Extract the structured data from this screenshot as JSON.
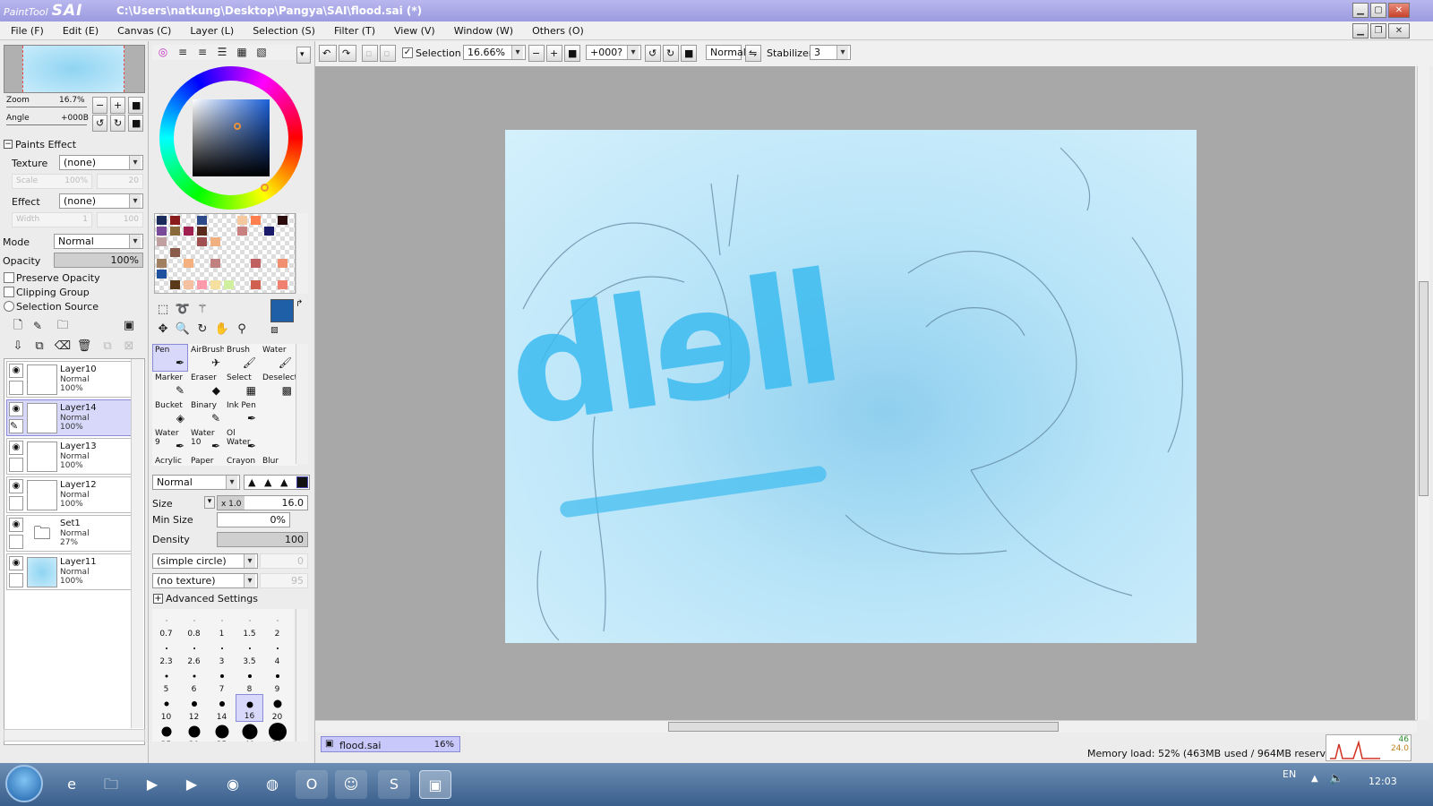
{
  "window": {
    "app_logo_small": "PaintTool",
    "app_logo_big": "SAI",
    "path": "C:\\Users\\natkung\\Desktop\\Pangya\\SAI\\flood.sai (*)"
  },
  "menu": [
    "File (F)",
    "Edit (E)",
    "Canvas (C)",
    "Layer (L)",
    "Selection (S)",
    "Filter (T)",
    "View (V)",
    "Window (W)",
    "Others (O)"
  ],
  "toolbar": {
    "selection_label": "Selection",
    "zoom_value": "16.66%",
    "angle_value": "+000?",
    "blend_mode": "Normal",
    "stabilizer_label": "Stabilizer",
    "stabilizer_value": "3"
  },
  "navigator": {
    "zoom_label": "Zoom",
    "zoom_value": "16.7%",
    "angle_label": "Angle",
    "angle_value": "+000B"
  },
  "paints_effect": {
    "header": "Paints Effect",
    "texture_label": "Texture",
    "texture_value": "(none)",
    "scale_label": "Scale",
    "scale_value": "100%",
    "scale_num": "20",
    "effect_label": "Effect",
    "effect_value": "(none)",
    "width_label": "Width",
    "width_value": "1",
    "width_num": "100"
  },
  "layer_props": {
    "mode_label": "Mode",
    "mode_value": "Normal",
    "opacity_label": "Opacity",
    "opacity_value": "100%",
    "preserve_opacity": "Preserve Opacity",
    "clipping_group": "Clipping Group",
    "selection_source": "Selection Source"
  },
  "layers": [
    {
      "name": "Layer10",
      "mode": "Normal",
      "opacity": "100%",
      "selected": false
    },
    {
      "name": "Layer14",
      "mode": "Normal",
      "opacity": "100%",
      "selected": true
    },
    {
      "name": "Layer13",
      "mode": "Normal",
      "opacity": "100%",
      "selected": false
    },
    {
      "name": "Layer12",
      "mode": "Normal",
      "opacity": "100%",
      "selected": false
    },
    {
      "name": "Set1",
      "mode": "Normal",
      "opacity": "27%",
      "selected": false
    },
    {
      "name": "Layer11",
      "mode": "Normal",
      "opacity": "100%",
      "selected": false
    }
  ],
  "tools": [
    {
      "name": "Pen",
      "icon": "✒"
    },
    {
      "name": "AirBrush",
      "icon": "✈"
    },
    {
      "name": "Brush",
      "icon": "🖌"
    },
    {
      "name": "Water",
      "icon": "🖌"
    },
    {
      "name": "Marker",
      "icon": "✎"
    },
    {
      "name": "Eraser",
      "icon": "◆"
    },
    {
      "name": "Select",
      "icon": "▦"
    },
    {
      "name": "Deselect",
      "icon": "▩"
    },
    {
      "name": "Bucket",
      "icon": "◈"
    },
    {
      "name": "Binary",
      "icon": "✎"
    },
    {
      "name": "Ink Pen",
      "icon": "✒"
    },
    {
      "name": "",
      "icon": ""
    },
    {
      "name": "Water 9",
      "icon": "✒"
    },
    {
      "name": "Water 10",
      "icon": "✒"
    },
    {
      "name": "Ol Water",
      "icon": "✒"
    },
    {
      "name": "",
      "icon": ""
    },
    {
      "name": "Acrylic",
      "icon": ""
    },
    {
      "name": "Paper",
      "icon": ""
    },
    {
      "name": "Crayon",
      "icon": ""
    },
    {
      "name": "Blur",
      "icon": ""
    }
  ],
  "brush": {
    "mode": "Normal",
    "size_label": "Size",
    "size_mult": "x 1.0",
    "size_value": "16.0",
    "min_size_label": "Min Size",
    "min_size_value": "0%",
    "density_label": "Density",
    "density_value": "100",
    "shape": "(simple circle)",
    "shape_num": "0",
    "texture": "(no texture)",
    "texture_num": "95",
    "advanced": "Advanced Settings"
  },
  "brush_sizes": [
    "0.7",
    "0.8",
    "1",
    "1.5",
    "2",
    "2.3",
    "2.6",
    "3",
    "3.5",
    "4",
    "5",
    "6",
    "7",
    "8",
    "9",
    "10",
    "12",
    "14",
    "16",
    "20",
    "25",
    "30",
    "35",
    "40",
    "50"
  ],
  "selected_size": "16",
  "colors": {
    "primary": "#1f5fa8",
    "secondary": "#c8eaf8"
  },
  "swatches": [
    "#1a2a5a",
    "#8b1c1c",
    "#ffffff",
    "#2c4a8a",
    "#ffffff",
    "#ffffff",
    "#f5c8a0",
    "#ff7f4f",
    "#ffffff",
    "#2b0b0b",
    "#7a4a9a",
    "#8a6a3a",
    "#a02050",
    "#5a2a1a",
    "#ffffff",
    "#ffffff",
    "#c88080",
    "#ffffff",
    "#1a1a6a",
    "#ffffff",
    "#c0a0a0",
    "#ffffff",
    "#ffffff",
    "#a05050",
    "#f0b080",
    "#ffffff",
    "#ffffff",
    "#ffffff",
    "#ffffff",
    "#ffffff",
    "#ffffff",
    "#8a5a4a",
    "#ffffff",
    "#ffffff",
    "#ffffff",
    "#ffffff",
    "#ffffff",
    "#ffffff",
    "#ffffff",
    "#ffffff",
    "#a08060",
    "#ffffff",
    "#f5b080",
    "#ffffff",
    "#c08080",
    "#ffffff",
    "#ffffff",
    "#c06060",
    "#ffffff",
    "#f09070",
    "#2050a0",
    "#ffffff",
    "#ffffff",
    "#ffffff",
    "#ffffff",
    "#ffffff",
    "#ffffff",
    "#ffffff",
    "#ffffff",
    "#ffffff",
    "#ffffff",
    "#5a3a1a",
    "#f5c0a0",
    "#ff9aaa",
    "#f5e0a0",
    "#d0f0a0",
    "#ffffff",
    "#d06050",
    "#ffffff",
    "#f08070"
  ],
  "canvas_text": "llelb",
  "document_tab": {
    "name": "flood.sai",
    "zoom": "16%"
  },
  "status": {
    "memory": "Memory load: 52% (463MB used / 964MB reserved)",
    "meter_vals": "46",
    "meter_vals2": "24.0"
  },
  "taskbar": {
    "lang": "EN",
    "clock": "12:03"
  }
}
